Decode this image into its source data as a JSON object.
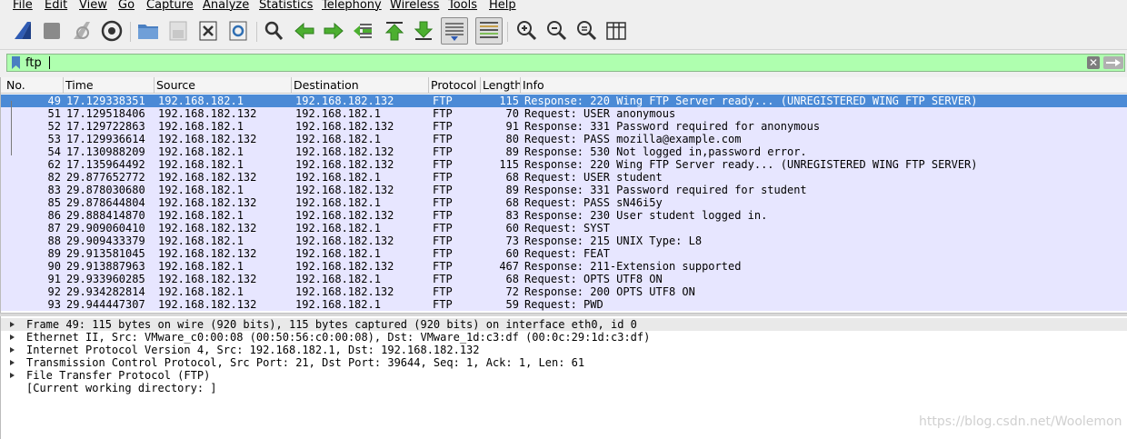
{
  "menu": [
    "File",
    "Edit",
    "View",
    "Go",
    "Capture",
    "Analyze",
    "Statistics",
    "Telephony",
    "Wireless",
    "Tools",
    "Help"
  ],
  "toolbar": {
    "buttons": [
      {
        "name": "start-capture-icon",
        "color": "#2f5bb3"
      },
      {
        "name": "stop-capture-icon",
        "color": "#8a8a8a"
      },
      {
        "name": "restart-capture-icon",
        "color": "#9a9a9a"
      },
      {
        "name": "capture-options-icon",
        "color": "#333333"
      },
      {
        "name": "open-file-icon",
        "color": "#4a7fc1"
      },
      {
        "name": "save-file-icon",
        "color": "#b5b5b5"
      },
      {
        "name": "close-file-icon",
        "color": "#333333"
      },
      {
        "name": "reload-file-icon",
        "color": "#2f6fb3"
      },
      {
        "name": "find-packet-icon",
        "color": "#333333"
      },
      {
        "name": "go-back-icon",
        "color": "#4caf30"
      },
      {
        "name": "go-forward-icon",
        "color": "#4caf30"
      },
      {
        "name": "go-to-packet-icon",
        "color": "#4caf30"
      },
      {
        "name": "go-first-packet-icon",
        "color": "#4caf30"
      },
      {
        "name": "go-last-packet-icon",
        "color": "#4caf30"
      },
      {
        "name": "auto-scroll-icon",
        "color": "#555555"
      },
      {
        "name": "colorize-icon",
        "color": "#555555"
      },
      {
        "name": "zoom-in-icon",
        "color": "#333333"
      },
      {
        "name": "zoom-out-icon",
        "color": "#333333"
      },
      {
        "name": "normal-size-icon",
        "color": "#333333"
      },
      {
        "name": "resize-columns-icon",
        "color": "#333333"
      }
    ]
  },
  "filter": {
    "value": "ftp",
    "clear_glyph": "✕"
  },
  "packet_list": {
    "columns": [
      "No.",
      "Time",
      "Source",
      "Destination",
      "Protocol",
      "Length",
      "Info"
    ],
    "rows": [
      {
        "no": "49",
        "time": "17.129338351",
        "src": "192.168.182.1",
        "dst": "192.168.182.132",
        "proto": "FTP",
        "len": "115",
        "info": "Response: 220 Wing FTP Server ready... (UNREGISTERED WING FTP SERVER)"
      },
      {
        "no": "51",
        "time": "17.129518406",
        "src": "192.168.182.132",
        "dst": "192.168.182.1",
        "proto": "FTP",
        "len": "70",
        "info": "Request: USER anonymous"
      },
      {
        "no": "52",
        "time": "17.129722863",
        "src": "192.168.182.1",
        "dst": "192.168.182.132",
        "proto": "FTP",
        "len": "91",
        "info": "Response: 331 Password required for anonymous"
      },
      {
        "no": "53",
        "time": "17.129936614",
        "src": "192.168.182.132",
        "dst": "192.168.182.1",
        "proto": "FTP",
        "len": "80",
        "info": "Request: PASS mozilla@example.com"
      },
      {
        "no": "54",
        "time": "17.130988209",
        "src": "192.168.182.1",
        "dst": "192.168.182.132",
        "proto": "FTP",
        "len": "89",
        "info": "Response: 530 Not logged in,password error."
      },
      {
        "no": "62",
        "time": "17.135964492",
        "src": "192.168.182.1",
        "dst": "192.168.182.132",
        "proto": "FTP",
        "len": "115",
        "info": "Response: 220 Wing FTP Server ready... (UNREGISTERED WING FTP SERVER)"
      },
      {
        "no": "82",
        "time": "29.877652772",
        "src": "192.168.182.132",
        "dst": "192.168.182.1",
        "proto": "FTP",
        "len": "68",
        "info": "Request: USER student"
      },
      {
        "no": "83",
        "time": "29.878030680",
        "src": "192.168.182.1",
        "dst": "192.168.182.132",
        "proto": "FTP",
        "len": "89",
        "info": "Response: 331 Password required for student"
      },
      {
        "no": "85",
        "time": "29.878644804",
        "src": "192.168.182.132",
        "dst": "192.168.182.1",
        "proto": "FTP",
        "len": "68",
        "info": "Request: PASS sN46i5y"
      },
      {
        "no": "86",
        "time": "29.888414870",
        "src": "192.168.182.1",
        "dst": "192.168.182.132",
        "proto": "FTP",
        "len": "83",
        "info": "Response: 230 User student logged in."
      },
      {
        "no": "87",
        "time": "29.909060410",
        "src": "192.168.182.132",
        "dst": "192.168.182.1",
        "proto": "FTP",
        "len": "60",
        "info": "Request: SYST"
      },
      {
        "no": "88",
        "time": "29.909433379",
        "src": "192.168.182.1",
        "dst": "192.168.182.132",
        "proto": "FTP",
        "len": "73",
        "info": "Response: 215 UNIX Type: L8"
      },
      {
        "no": "89",
        "time": "29.913581045",
        "src": "192.168.182.132",
        "dst": "192.168.182.1",
        "proto": "FTP",
        "len": "60",
        "info": "Request: FEAT"
      },
      {
        "no": "90",
        "time": "29.913887963",
        "src": "192.168.182.1",
        "dst": "192.168.182.132",
        "proto": "FTP",
        "len": "467",
        "info": "Response: 211-Extension supported"
      },
      {
        "no": "91",
        "time": "29.933960285",
        "src": "192.168.182.132",
        "dst": "192.168.182.1",
        "proto": "FTP",
        "len": "68",
        "info": "Request: OPTS UTF8 ON"
      },
      {
        "no": "92",
        "time": "29.934282814",
        "src": "192.168.182.1",
        "dst": "192.168.182.132",
        "proto": "FTP",
        "len": "72",
        "info": "Response: 200 OPTS UTF8 ON"
      },
      {
        "no": "93",
        "time": "29.944447307",
        "src": "192.168.182.132",
        "dst": "192.168.182.1",
        "proto": "FTP",
        "len": "59",
        "info": "Request: PWD"
      }
    ],
    "selected_index": 0
  },
  "details": [
    {
      "text": "Frame 49: 115 bytes on wire (920 bits), 115 bytes captured (920 bits) on interface eth0, id 0",
      "expandable": true
    },
    {
      "text": "Ethernet II, Src: VMware_c0:00:08 (00:50:56:c0:00:08), Dst: VMware_1d:c3:df (00:0c:29:1d:c3:df)",
      "expandable": true
    },
    {
      "text": "Internet Protocol Version 4, Src: 192.168.182.1, Dst: 192.168.182.132",
      "expandable": true
    },
    {
      "text": "Transmission Control Protocol, Src Port: 21, Dst Port: 39644, Seq: 1, Ack: 1, Len: 61",
      "expandable": true
    },
    {
      "text": "File Transfer Protocol (FTP)",
      "expandable": true
    },
    {
      "text": "[Current working directory: ]",
      "expandable": false
    }
  ],
  "watermark": "https://blog.csdn.net/Woolemon",
  "colors": {
    "selected_row": "#4b8ad6",
    "ftp_row": "#e7e6ff",
    "filter_valid": "#afffaf"
  }
}
